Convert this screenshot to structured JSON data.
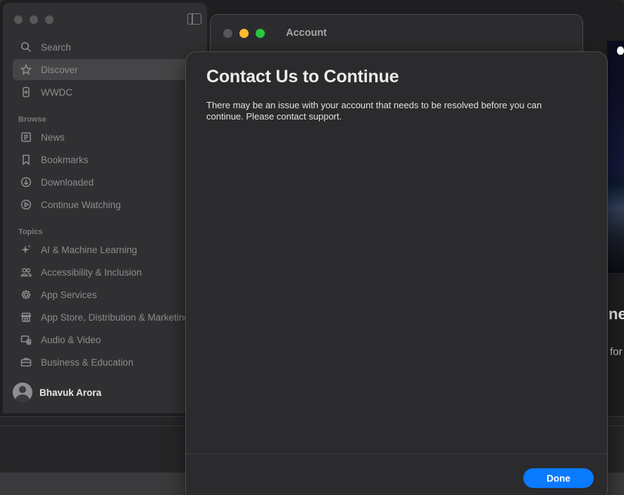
{
  "sidebar": {
    "nav": [
      {
        "label": "Search",
        "icon": "search-icon"
      },
      {
        "label": "Discover",
        "icon": "star-icon",
        "selected": true
      },
      {
        "label": "WWDC",
        "icon": "device-icon"
      }
    ],
    "browse_heading": "Browse",
    "browse": [
      {
        "label": "News",
        "icon": "newspaper-icon"
      },
      {
        "label": "Bookmarks",
        "icon": "bookmark-icon"
      },
      {
        "label": "Downloaded",
        "icon": "download-icon"
      },
      {
        "label": "Continue Watching",
        "icon": "play-circle-icon"
      }
    ],
    "topics_heading": "Topics",
    "topics": [
      {
        "label": "AI & Machine Learning",
        "icon": "sparkles-icon"
      },
      {
        "label": "Accessibility & Inclusion",
        "icon": "people-icon"
      },
      {
        "label": "App Services",
        "icon": "gear-icon"
      },
      {
        "label": "App Store, Distribution & Marketing",
        "icon": "storefront-icon"
      },
      {
        "label": "Audio & Video",
        "icon": "audio-video-icon"
      },
      {
        "label": "Business & Education",
        "icon": "briefcase-icon"
      }
    ],
    "profile_name": "Bhavuk Arora"
  },
  "account_window": {
    "title": "Account"
  },
  "sheet": {
    "title": "Contact Us to Continue",
    "message": "There may be an issue with your account that needs to be resolved before you can continue. Please contact support.",
    "done_label": "Done"
  },
  "content": {
    "heading_fragment": "ne",
    "text_fragment": "for"
  },
  "colors": {
    "accent": "#0a7aff",
    "traffic_min": "#febc2e",
    "traffic_max": "#28c840"
  }
}
